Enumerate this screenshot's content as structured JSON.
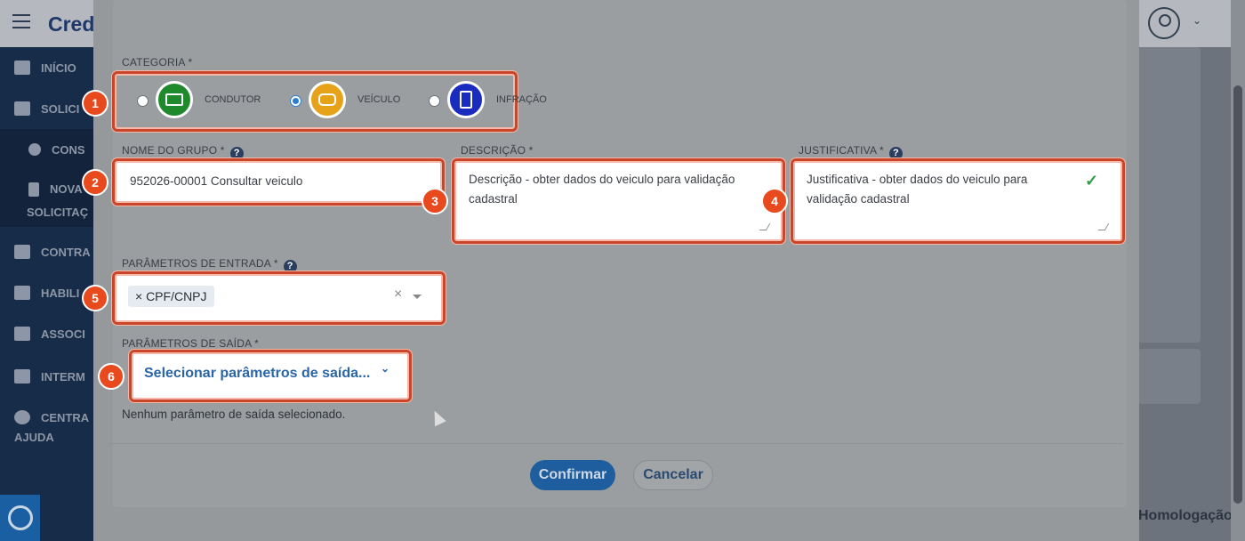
{
  "app": {
    "brand": "Cred",
    "homologation": "Homologação",
    "profile_icon": "user-circle-icon"
  },
  "sidebar": {
    "items": [
      {
        "label": "INÍCIO",
        "icon": "home-icon"
      },
      {
        "label": "SOLICI",
        "icon": "edit-icon"
      },
      {
        "label": "CONS",
        "icon": "search-icon"
      },
      {
        "label": "NOVA",
        "icon": "file-icon"
      },
      {
        "label": "SOLICITAÇ",
        "icon": ""
      },
      {
        "label": "CONTRA",
        "icon": "handshake-icon"
      },
      {
        "label": "HABILI",
        "icon": "id-card-icon"
      },
      {
        "label": "ASSOCI",
        "icon": "users-icon"
      },
      {
        "label": "INTERM",
        "icon": "user-tie-icon"
      },
      {
        "label": "CENTRA",
        "icon": "question-icon"
      },
      {
        "label": "AJUDA",
        "icon": ""
      }
    ]
  },
  "form": {
    "categoria": {
      "label": "CATEGORIA *",
      "options": [
        {
          "label": "CONDUTOR",
          "selected": false,
          "color": "#1e8a2c",
          "icon": "id-card-icon"
        },
        {
          "label": "VEÍCULO",
          "selected": true,
          "color": "#e6a31a",
          "icon": "car-icon"
        },
        {
          "label": "INFRAÇÃO",
          "selected": false,
          "color": "#1a2bbf",
          "icon": "document-dollar-icon"
        }
      ]
    },
    "nome_grupo": {
      "label": "NOME DO GRUPO *",
      "value": "952026-00001 Consultar veiculo"
    },
    "descricao": {
      "label": "DESCRIÇÃO *",
      "value": "Descrição -  obter dados do veiculo para validação cadastral"
    },
    "justificativa": {
      "label": "JUSTIFICATIVA *",
      "value": "Justificativa - obter dados do veiculo para validação cadastral"
    },
    "param_entrada": {
      "label": "PARÂMETROS DE ENTRADA *",
      "tags": [
        "× CPF/CNPJ"
      ],
      "clear": "×"
    },
    "param_saida": {
      "label": "PARÂMETROS DE SAÍDA *",
      "placeholder": "Selecionar parâmetros de saída...",
      "empty_text": "Nenhum parâmetro de saída selecionado."
    },
    "help_glyph": "?"
  },
  "annotations": [
    "1",
    "2",
    "3",
    "4",
    "5",
    "6"
  ],
  "actions": {
    "confirm": "Confirmar",
    "cancel": "Cancelar"
  },
  "colors": {
    "highlight": "#c9462a",
    "badge": "#e8491d",
    "primary": "#1f5e9e"
  }
}
